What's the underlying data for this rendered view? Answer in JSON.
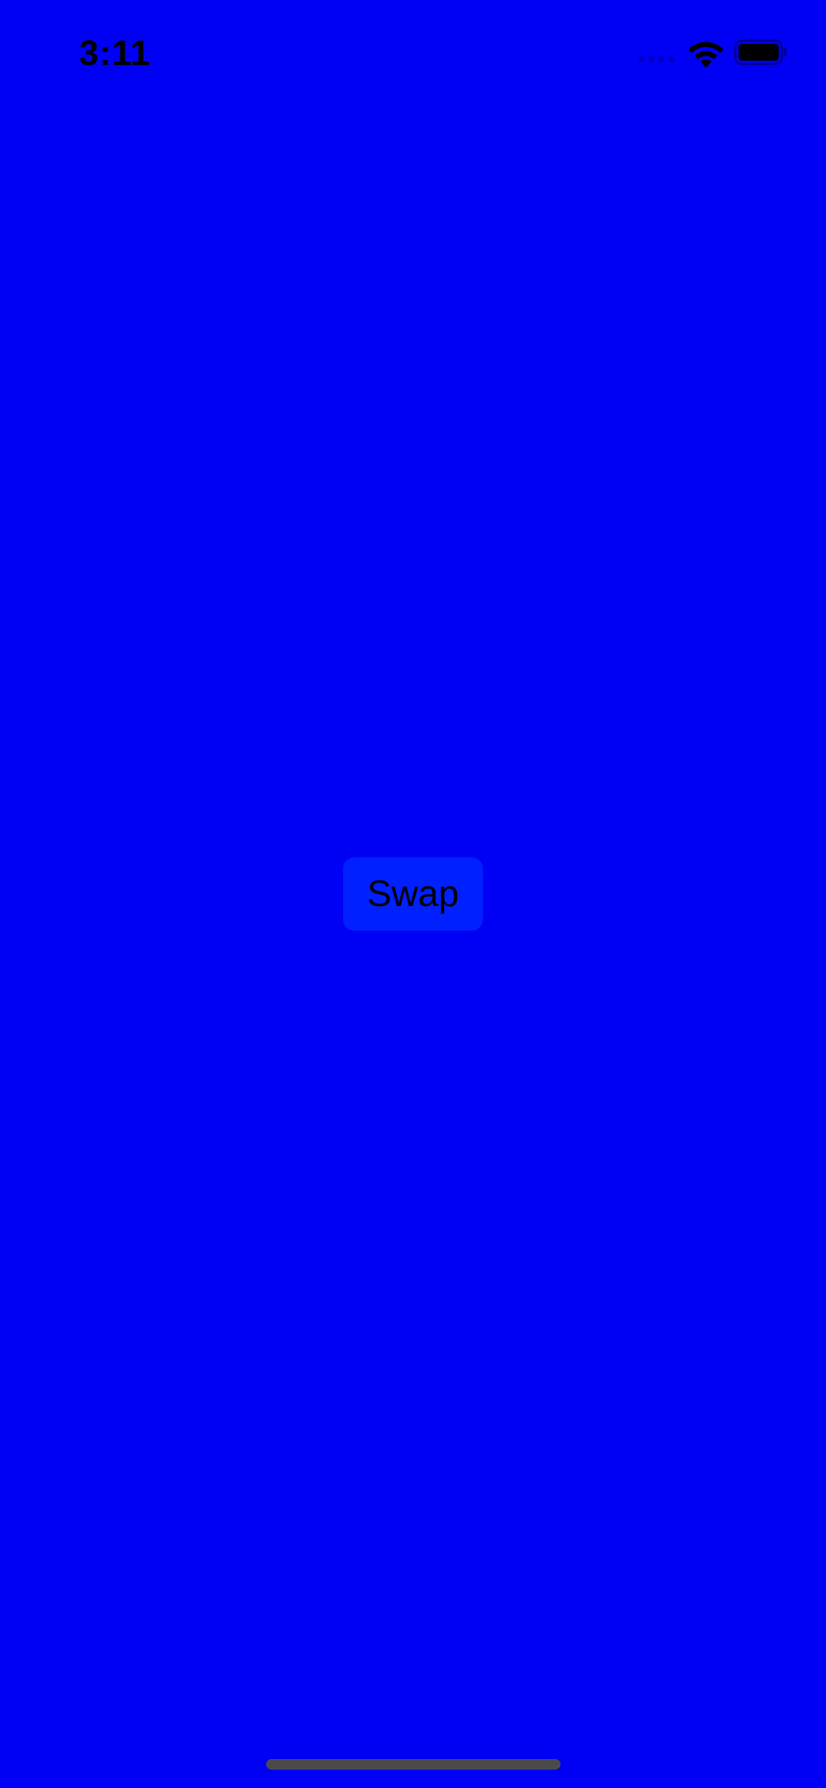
{
  "status_bar": {
    "time": "3:11",
    "signal_icon": "cellular-signal-icon",
    "wifi_icon": "wifi-icon",
    "battery_icon": "battery-icon"
  },
  "main": {
    "swap_button_label": "Swap"
  },
  "colors": {
    "background": "#0000F5",
    "button_background": "#0020FF",
    "text": "#000000",
    "home_indicator": "#4A4A4A"
  }
}
